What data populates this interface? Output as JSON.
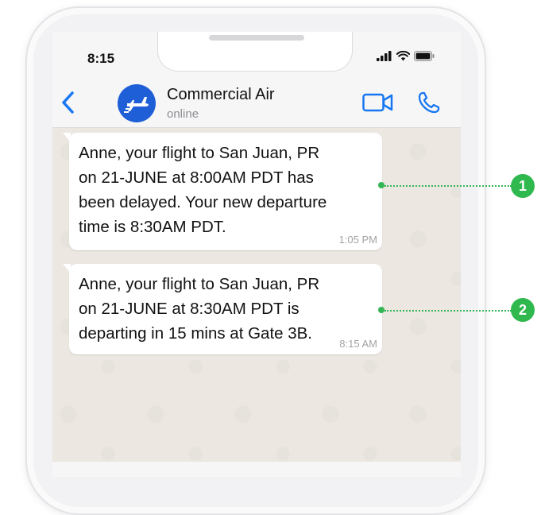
{
  "status_bar": {
    "time": "8:15",
    "icons": [
      "signal-icon",
      "wifi-icon",
      "battery-icon"
    ]
  },
  "header": {
    "contact_name": "Commercial Air",
    "contact_status": "online",
    "icons": [
      "back-arrow-icon",
      "airplane-icon",
      "video-call-icon",
      "phone-call-icon"
    ]
  },
  "messages": [
    {
      "text": "Anne, your flight to San Juan, PR\non 21-JUNE at 8:00AM PDT has\nbeen delayed. Your new departure\ntime is 8:30AM PDT.",
      "time": "1:05 PM"
    },
    {
      "text": "Anne, your flight to San Juan, PR\non 21-JUNE at 8:30AM PDT is\ndeparting in 15 mins at Gate 3B.",
      "time": "8:15 AM"
    }
  ],
  "callouts": [
    "1",
    "2"
  ],
  "colors": {
    "accent_blue": "#1e5fd8",
    "callout_green": "#2fb84e",
    "chat_bg": "#ece7e1"
  }
}
